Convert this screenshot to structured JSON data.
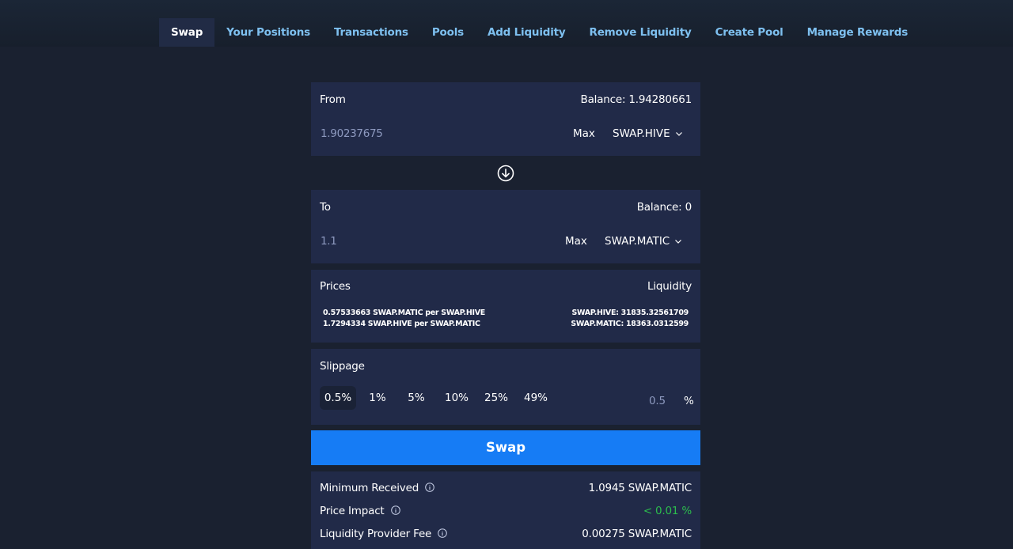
{
  "nav": {
    "tabs": [
      {
        "label": "Swap",
        "active": true
      },
      {
        "label": "Your Positions"
      },
      {
        "label": "Transactions"
      },
      {
        "label": "Pools"
      },
      {
        "label": "Add Liquidity"
      },
      {
        "label": "Remove Liquidity"
      },
      {
        "label": "Create Pool"
      },
      {
        "label": "Manage Rewards"
      }
    ]
  },
  "from": {
    "label": "From",
    "balance": "Balance: 1.94280661",
    "amount": "1.90237675",
    "max": "Max",
    "token": "SWAP.HIVE"
  },
  "to": {
    "label": "To",
    "balance": "Balance: 0",
    "amount": "1.1",
    "max": "Max",
    "token": "SWAP.MATIC"
  },
  "prices": {
    "label": "Prices",
    "liquidity_label": "Liquidity",
    "price1": "0.57533663 SWAP.MATIC per SWAP.HIVE",
    "price2": "1.7294334 SWAP.HIVE per SWAP.MATIC",
    "liq1": "SWAP.HIVE: 31835.32561709",
    "liq2": "SWAP.MATIC: 18363.0312599"
  },
  "slippage": {
    "label": "Slippage",
    "options": [
      "0.5%",
      "1%",
      "5%",
      "10%",
      "25%",
      "49%"
    ],
    "custom_value": "0.5",
    "percent": "%"
  },
  "swap_button": "Swap",
  "details": {
    "min_received_label": "Minimum Received",
    "min_received_value": "1.0945 SWAP.MATIC",
    "price_impact_label": "Price Impact",
    "price_impact_value": "< 0.01 %",
    "lp_fee_label": "Liquidity Provider Fee",
    "lp_fee_value": "0.00275 SWAP.MATIC"
  },
  "colors": {
    "accent": "#167cf5",
    "nav_text": "#7ec0f0",
    "panel": "#212a48",
    "positive": "#2cbd4d"
  }
}
